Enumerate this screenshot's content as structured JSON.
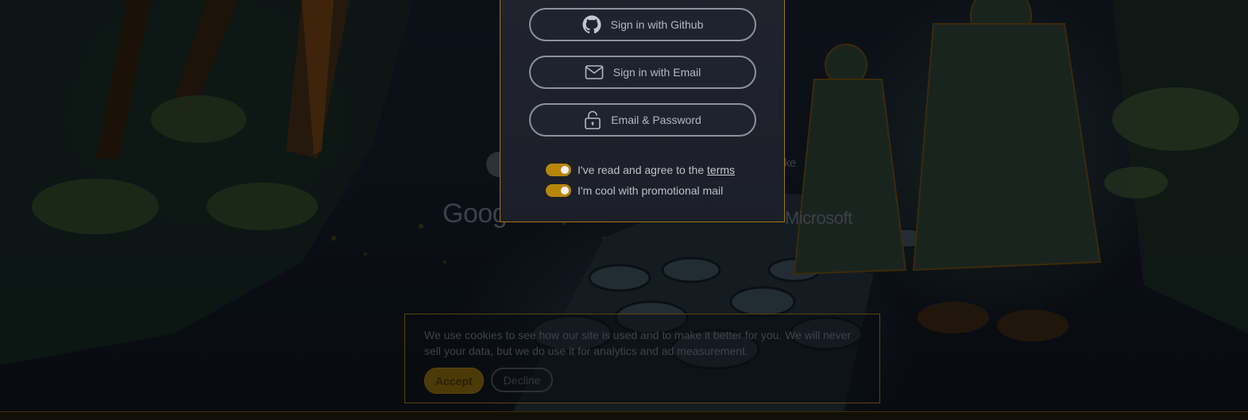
{
  "modal": {
    "auth_buttons": [
      {
        "label": "Sign in with Github",
        "icon": "github-icon"
      },
      {
        "label": "Sign in with Email",
        "icon": "mail-icon"
      },
      {
        "label": "Email & Password",
        "icon": "unlock-icon"
      }
    ],
    "consent": {
      "terms_prefix": "I've read and agree to the ",
      "terms_link": "terms",
      "terms_checked": true,
      "promo_label": "I'm cool with promotional mail",
      "promo_checked": true
    }
  },
  "background": {
    "logo_left": "Goog",
    "logo_right": "Microsoft",
    "partial_text": "ke"
  },
  "cookie_banner": {
    "message": "We use cookies to see how our site is used and to make it better for you. We will never sell your data, but we do use it for analytics and ad measurement.",
    "accept_label": "Accept",
    "decline_label": "Decline"
  },
  "colors": {
    "accent": "#b8860b",
    "modal_bg": "#1f2330",
    "modal_border": "#a3740e"
  }
}
